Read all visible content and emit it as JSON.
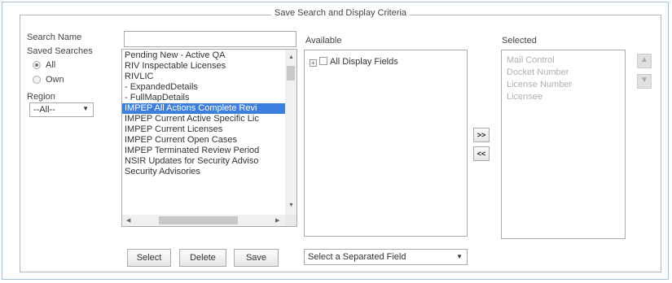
{
  "panel": {
    "legend": "Save Search and Display Criteria"
  },
  "left": {
    "search_name_label": "Search Name",
    "search_name_value": "",
    "saved_searches_label": "Saved Searches",
    "radio_all_label": "All",
    "radio_own_label": "Own",
    "region_label": "Region",
    "region_value": "--All--"
  },
  "saved_list": {
    "items": [
      "Pending New - Active QA",
      "RIV Inspectable Licenses",
      "RIVLIC",
      "- ExpandedDetails",
      "- FullMapDetails",
      "IMPEP All Actions Complete Revi",
      "IMPEP Current Active Specific Lic",
      "IMPEP Current Licenses",
      "IMPEP Current Open Cases",
      "IMPEP Terminated Review Period",
      "NSIR Updates for Security Adviso",
      "Security Advisories"
    ],
    "selected_index": 5
  },
  "buttons": {
    "select": "Select",
    "delete": "Delete",
    "save": "Save"
  },
  "available": {
    "label": "Available",
    "tree_root": "All Display Fields",
    "separated_field_value": "Select a Separated Field"
  },
  "move": {
    "add": ">>",
    "remove": "<<"
  },
  "selected": {
    "label": "Selected",
    "items": [
      "Mail Control",
      "Docket Number",
      "License Number",
      "Licensee"
    ]
  },
  "order": {
    "up": "▲",
    "down": "▼"
  }
}
